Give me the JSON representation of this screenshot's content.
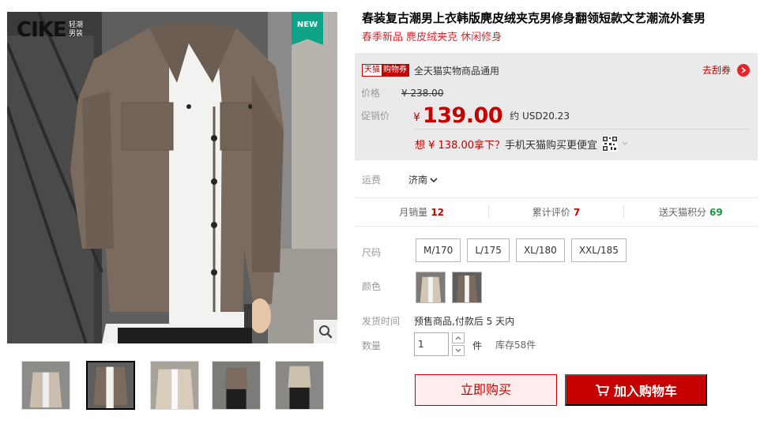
{
  "gallery": {
    "logo_text": "CIKE",
    "logo_sub_line1": "轻潮",
    "logo_sub_line2": "男装",
    "new_badge": "NEW",
    "zoom_icon": "magnifier-icon",
    "thumbnails": [
      "thumb-1",
      "thumb-2",
      "thumb-3",
      "thumb-4",
      "thumb-5"
    ],
    "active_thumbnail": 2
  },
  "product": {
    "title": "春装复古潮男上衣韩版麂皮绒夹克男修身翻领短款文艺潮流外套男",
    "subtitle": "春季新品 麂皮绒夹克 休闲修身"
  },
  "price_panel": {
    "coupon_tag_1": "天猫",
    "coupon_tag_2": "购物券",
    "coupon_text": "全天猫实物商品通用",
    "go_coupon": "去刮券",
    "orig_label": "价格",
    "orig_price": "¥ 238.00",
    "sale_label": "促销价",
    "currency": "¥",
    "sale_price": "139.00",
    "usd": "约 USD20.23",
    "mobile_prefix": "想 ¥ 138.00拿下？",
    "mobile_suffix": "手机天猫购买更便宜"
  },
  "shipping": {
    "label": "运费",
    "city": "济南"
  },
  "stats": {
    "monthly_sales_label": "月销量",
    "monthly_sales": "12",
    "reviews_label": "累计评价",
    "reviews": "7",
    "points_label": "送天猫积分",
    "points": "69"
  },
  "options": {
    "size_label": "尺码",
    "sizes": [
      "M/170",
      "L/175",
      "XL/180",
      "XXL/185"
    ],
    "color_label": "颜色"
  },
  "delivery": {
    "label": "发货时间",
    "value": "预售商品,付款后 5 天内"
  },
  "quantity": {
    "label": "数量",
    "value": "1",
    "unit": "件",
    "stock": "库存58件"
  },
  "actions": {
    "buy_now": "立即购买",
    "add_cart": "加入购物车"
  },
  "colors": {
    "accent": "#c40000",
    "coupon_red": "#e5242b",
    "points_green": "#139b3b",
    "new_badge": "#0fa487"
  }
}
